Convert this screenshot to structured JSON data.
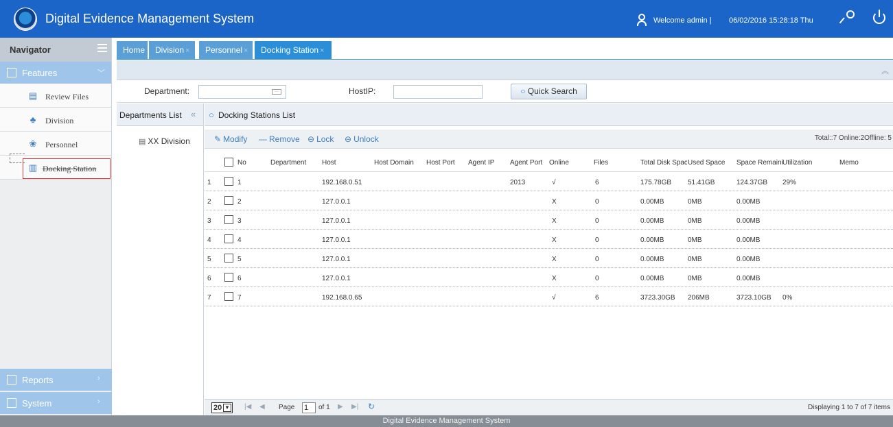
{
  "header": {
    "title": "Digital Evidence Management System",
    "welcome": "Welcome  admin |",
    "datetime": "06/02/2016 15:28:18 Thu"
  },
  "sidebar": {
    "title": "Navigator",
    "features_label": "Features",
    "items": [
      {
        "label": "Review Files",
        "icon": "review-files-icon"
      },
      {
        "label": "Division",
        "icon": "division-icon"
      },
      {
        "label": "Personnel",
        "icon": "personnel-icon"
      },
      {
        "label": "Docking Station",
        "icon": "docking-station-icon"
      }
    ],
    "reports_label": "Reports",
    "system_label": "System"
  },
  "tabs": [
    {
      "label": "Home"
    },
    {
      "label": "Division"
    },
    {
      "label": "Personnel"
    },
    {
      "label": "Docking Station"
    }
  ],
  "search": {
    "department_label": "Department:",
    "department_value": "",
    "hostip_label": "HostIP:",
    "hostip_value": "",
    "quick_search_label": "Quick Search"
  },
  "departments": {
    "title": "Departments List",
    "items": [
      "XX Division"
    ]
  },
  "list": {
    "title": "Docking Stations List",
    "tools": {
      "modify": "Modify",
      "remove": "Remove",
      "lock": "Lock",
      "unlock": "Unlock"
    },
    "totals": "Total::7 Online:2Offline: 5",
    "columns": [
      "No",
      "Department",
      "Host",
      "Host Domain",
      "Host Port",
      "Agent IP",
      "Agent Port",
      "Online",
      "Files",
      "Total Disk Spac",
      "Used Space",
      "Space Remaini",
      "Utilization",
      "Memo"
    ],
    "rows": [
      {
        "idx": "1",
        "no": "1",
        "department": "",
        "host": "192.168.0.51",
        "agent_port": "2013",
        "online": "√",
        "files": "6",
        "total": "175.78GB",
        "used": "51.41GB",
        "remain": "124.37GB",
        "util": "29%"
      },
      {
        "idx": "2",
        "no": "2",
        "department": "",
        "host": "127.0.0.1",
        "agent_port": "",
        "online": "X",
        "files": "0",
        "total": "0.00MB",
        "used": "0MB",
        "remain": "0.00MB",
        "util": ""
      },
      {
        "idx": "3",
        "no": "3",
        "department": "",
        "host": "127.0.0.1",
        "agent_port": "",
        "online": "X",
        "files": "0",
        "total": "0.00MB",
        "used": "0MB",
        "remain": "0.00MB",
        "util": ""
      },
      {
        "idx": "4",
        "no": "4",
        "department": "",
        "host": "127.0.0.1",
        "agent_port": "",
        "online": "X",
        "files": "0",
        "total": "0.00MB",
        "used": "0MB",
        "remain": "0.00MB",
        "util": ""
      },
      {
        "idx": "5",
        "no": "5",
        "department": "",
        "host": "127.0.0.1",
        "agent_port": "",
        "online": "X",
        "files": "0",
        "total": "0.00MB",
        "used": "0MB",
        "remain": "0.00MB",
        "util": ""
      },
      {
        "idx": "6",
        "no": "6",
        "department": "",
        "host": "127.0.0.1",
        "agent_port": "",
        "online": "X",
        "files": "0",
        "total": "0.00MB",
        "used": "0MB",
        "remain": "0.00MB",
        "util": ""
      },
      {
        "idx": "7",
        "no": "7",
        "department": "",
        "host": "192.168.0.65",
        "agent_port": "",
        "online": "√",
        "files": "6",
        "total": "3723.30GB",
        "used": "206MB",
        "remain": "3723.10GB",
        "util": "0%"
      }
    ]
  },
  "pager": {
    "page_size": "20",
    "page_label": "Page",
    "page_value": "1",
    "of_label": "of 1",
    "displaying": "Displaying 1 to 7 of 7 items"
  },
  "footer": {
    "text": "Digital Evidence Management System"
  },
  "colors": {
    "header": "#1b64c8",
    "tab_active": "#2a8fd8",
    "tab": "#5a9fd6",
    "menu": "#9fc6ea",
    "footer": "#868d94"
  }
}
